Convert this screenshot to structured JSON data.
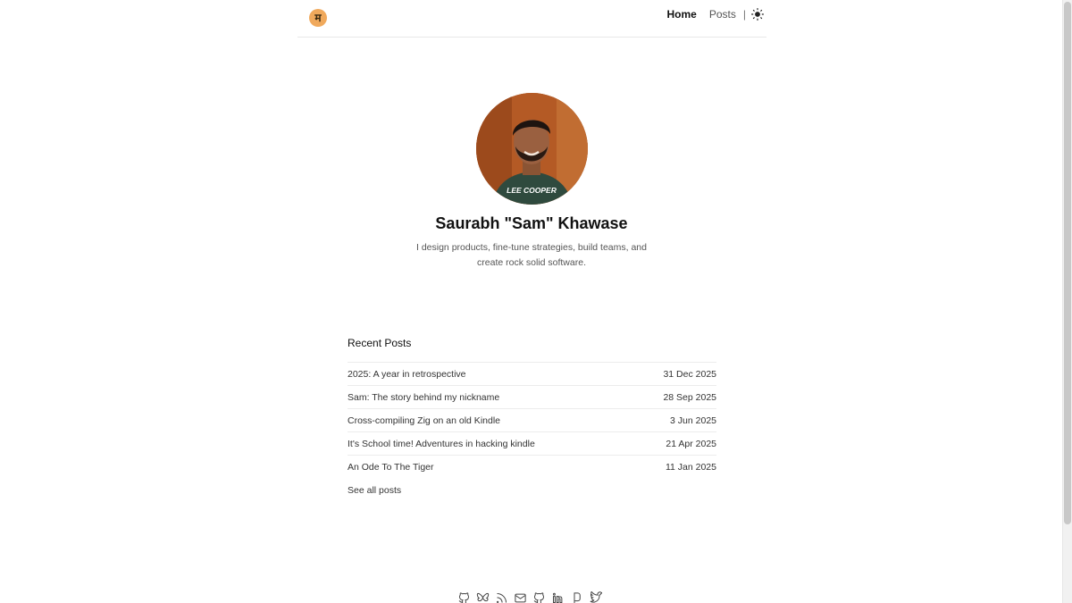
{
  "header": {
    "logo_text": "म",
    "nav": {
      "home": "Home",
      "posts": "Posts",
      "separator": "|"
    },
    "theme_toggle_icon": "sun-icon"
  },
  "hero": {
    "name": "Saurabh \"Sam\" Khawase",
    "bio": "I design products, fine-tune strategies, build teams, and create rock solid software.",
    "avatar_shirt_text": "LEE COOPER"
  },
  "recent_posts": {
    "title": "Recent Posts",
    "items": [
      {
        "title": "2025: A year in retrospective",
        "date": "31 Dec 2025"
      },
      {
        "title": "Sam: The story behind my nickname",
        "date": "28 Sep 2025"
      },
      {
        "title": "Cross-compiling Zig on an old Kindle",
        "date": "3 Jun 2025"
      },
      {
        "title": "It's School time! Adventures in hacking kindle",
        "date": "21 Apr 2025"
      },
      {
        "title": "An Ode To The Tiger",
        "date": "11 Jan 2025"
      }
    ],
    "see_all": "See all posts"
  },
  "footer": {
    "icons": [
      "github-icon",
      "bluesky-icon",
      "rss-icon",
      "mail-icon",
      "gitlab-icon",
      "linkedin-icon",
      "sourcehut-icon",
      "twitter-icon"
    ]
  },
  "colors": {
    "logo_bg": "#f0a95c",
    "text_primary": "#111111",
    "text_secondary": "#555555"
  }
}
